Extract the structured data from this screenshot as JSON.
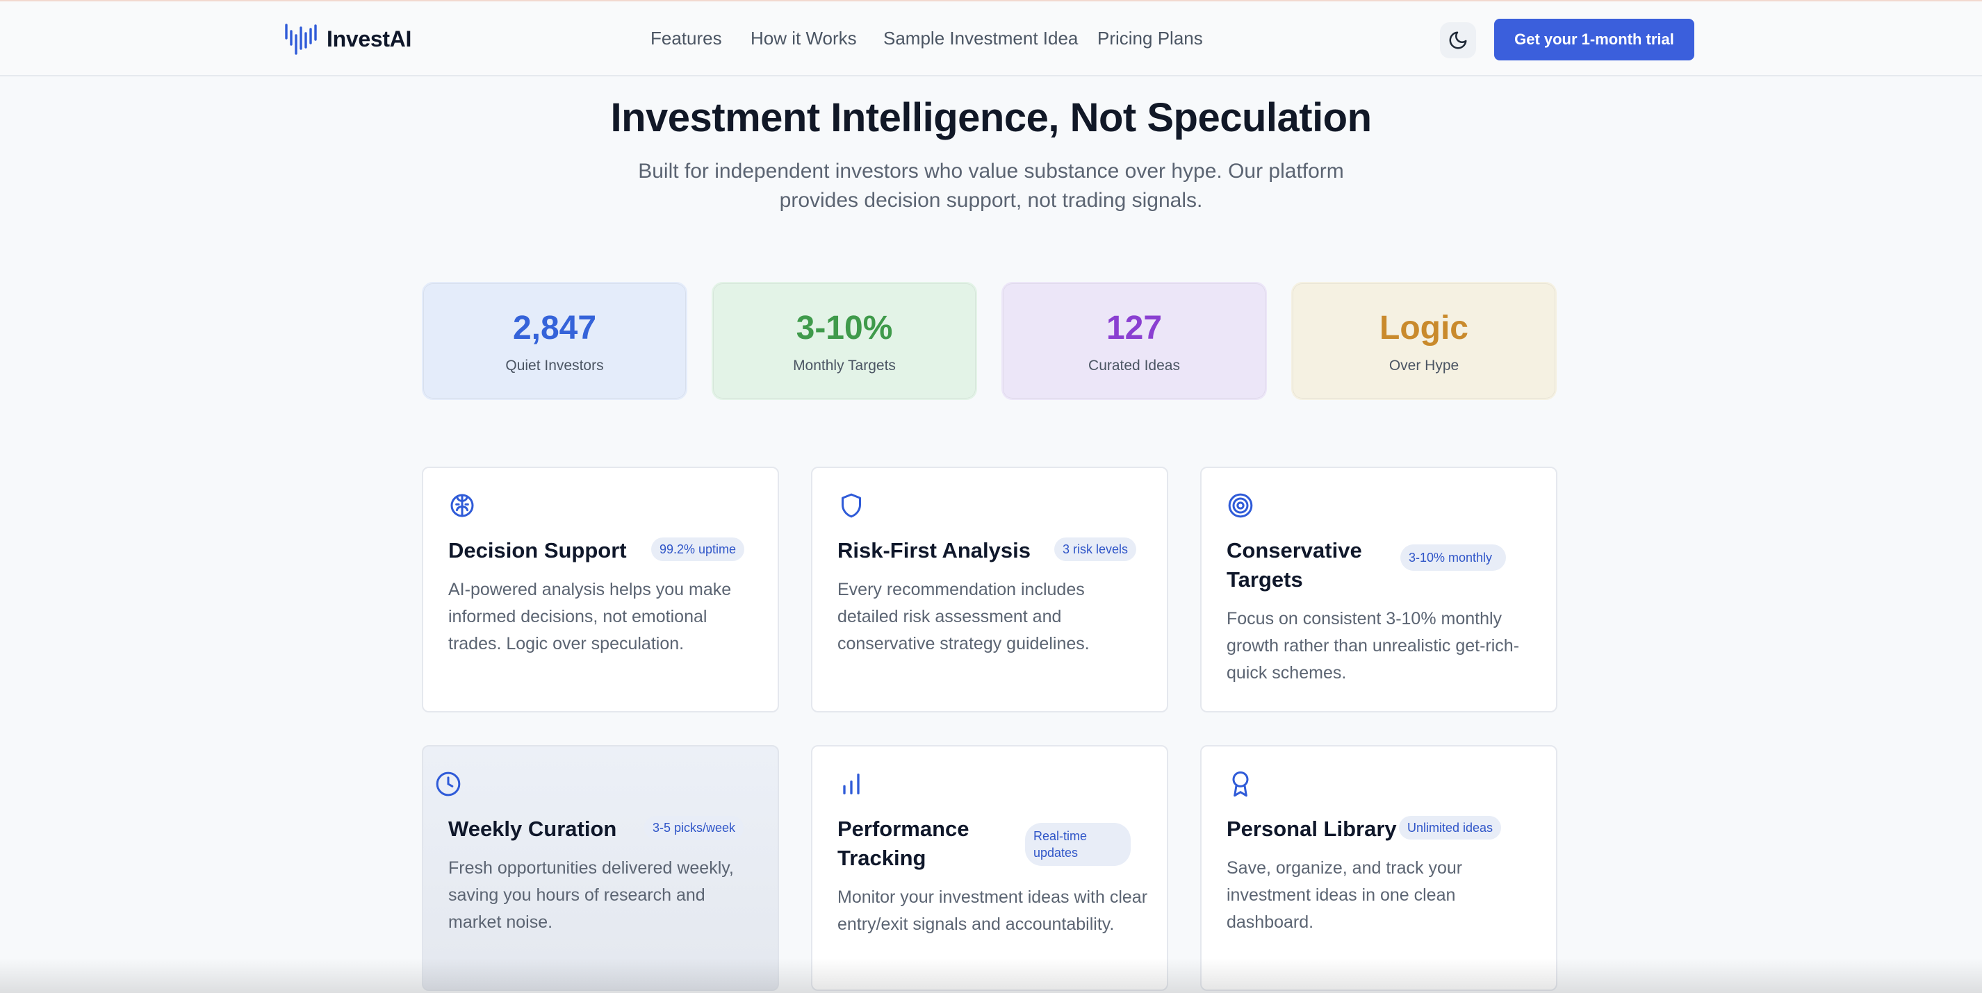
{
  "brand": {
    "name": "InvestAI"
  },
  "nav": {
    "links": [
      "Features",
      "How it Works",
      "Sample Investment Idea",
      "Pricing Plans"
    ],
    "theme_icon": "moon-icon",
    "cta_label": "Get your 1-month trial"
  },
  "hero": {
    "title": "Investment Intelligence, Not Speculation",
    "subtitle": "Built for independent investors who value substance over hype. Our platform provides decision support, not trading signals."
  },
  "stats": [
    {
      "value": "2,847",
      "label": "Quiet Investors",
      "color": "#3563d9",
      "bg": "#e4ecfa"
    },
    {
      "value": "3-10%",
      "label": "Monthly Targets",
      "color": "#3f9a4b",
      "bg": "#e3f3e7"
    },
    {
      "value": "127",
      "label": "Curated Ideas",
      "color": "#8a3fd1",
      "bg": "#ece6f8"
    },
    {
      "value": "Logic",
      "label": "Over Hype",
      "color": "#c98a2c",
      "bg": "#f5f1e2"
    }
  ],
  "features": [
    {
      "icon": "brain-icon",
      "title": "Decision Support",
      "badge": "99.2% uptime",
      "desc": "AI-powered analysis helps you make informed decisions, not emotional trades. Logic over speculation."
    },
    {
      "icon": "shield-icon",
      "title": "Risk-First Analysis",
      "badge": "3 risk levels",
      "desc": "Every recommendation includes detailed risk assessment and conservative strategy guidelines."
    },
    {
      "icon": "target-icon",
      "title": "Conservative Targets",
      "badge": "3-10% monthly",
      "desc": "Focus on consistent 3-10% monthly growth rather than unrealistic get-rich-quick schemes."
    },
    {
      "icon": "clock-icon",
      "title": "Weekly Curation",
      "badge": "3-5 picks/week",
      "desc": "Fresh opportunities delivered weekly, saving you hours of research and market noise."
    },
    {
      "icon": "bar-chart-icon",
      "title": "Performance Tracking",
      "badge": "Real-time updates",
      "desc": "Monitor your investment ideas with clear entry/exit signals and accountability."
    },
    {
      "icon": "award-icon",
      "title": "Personal Library",
      "badge": "Unlimited ideas",
      "desc": "Save, organize, and track your investment ideas in one clean dashboard."
    }
  ],
  "accent": "#3b5fdc"
}
